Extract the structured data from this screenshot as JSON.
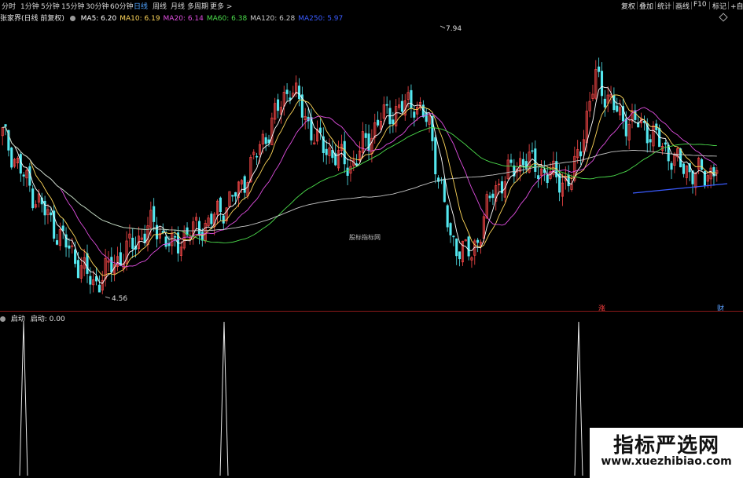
{
  "toolbar": {
    "periods": [
      "分时",
      "1分钟",
      "5分钟",
      "15分钟",
      "30分钟",
      "60分钟",
      "日线",
      "周线",
      "月线",
      "多周期",
      "更多 >"
    ],
    "active": "日线",
    "right": [
      "复权",
      "叠加",
      "统计",
      "画线",
      "F10",
      "标记",
      "+自选"
    ]
  },
  "main_panel": {
    "title": "张家界(日线 前复权)",
    "ma": [
      {
        "label": "MA5: 6.20",
        "color": "#ffffff"
      },
      {
        "label": "MA10: 6.19",
        "color": "#ffd75a"
      },
      {
        "label": "MA20: 6.14",
        "color": "#e04ee0"
      },
      {
        "label": "MA60: 6.38",
        "color": "#4cdd4c"
      },
      {
        "label": "MA120: 6.28",
        "color": "#c8c8c8"
      },
      {
        "label": "MA250: 5.97",
        "color": "#3a5bff"
      }
    ],
    "high_label": "7.94",
    "low_label": "4.56",
    "center_watermark": "股标指标网",
    "tag_red": "涨",
    "tag_blue": "财"
  },
  "indicator_panel": {
    "title": "启动",
    "value_label": "启动: 0.00",
    "spikes": [
      30,
      285,
      736
    ]
  },
  "watermark": {
    "title": "指标严选网",
    "url": "www.xuezhibiao.com"
  },
  "colors": {
    "up": "#ff4a4a",
    "down": "#54e8f0",
    "active_tab": "#4fa3ff"
  }
}
